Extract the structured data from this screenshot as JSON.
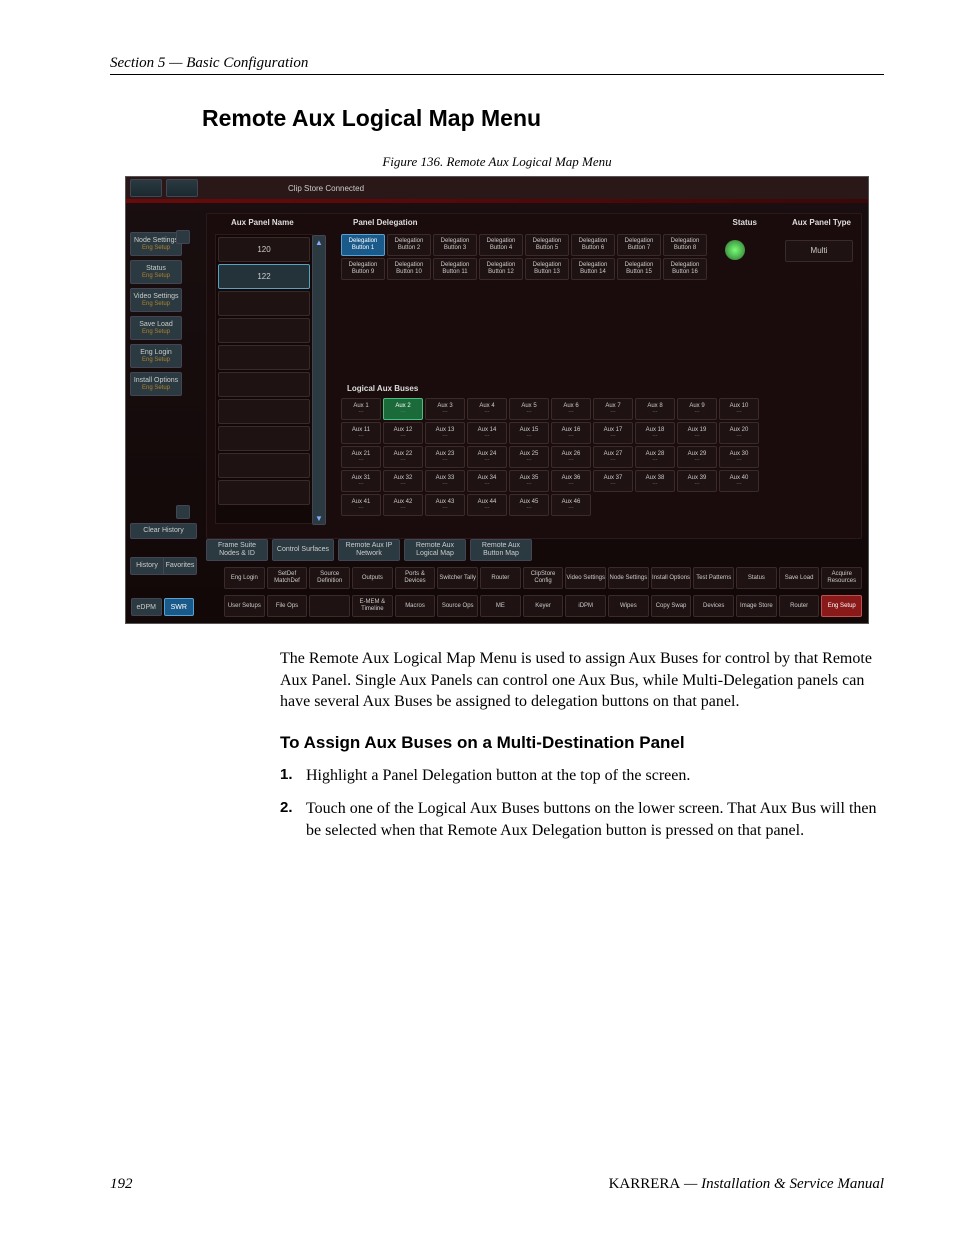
{
  "header": {
    "section_label": "Section 5 — Basic Configuration"
  },
  "heading": "Remote Aux Logical Map Menu",
  "figure_caption": "Figure 136.  Remote Aux Logical Map Menu",
  "screenshot": {
    "topbar_text": "Clip Store Connected",
    "columns": {
      "aux_panel_name": "Aux Panel Name",
      "panel_delegation": "Panel Delegation",
      "status": "Status",
      "aux_panel_type": "Aux Panel Type",
      "logical_aux_buses": "Logical Aux Buses"
    },
    "aux_panel_type_value": "Multi",
    "aux_panel_list": [
      "120",
      "122",
      "",
      "",
      "",
      "",
      "",
      "",
      "",
      ""
    ],
    "delegation_buttons": [
      "Delegation Button 1",
      "Delegation Button 2",
      "Delegation Button 3",
      "Delegation Button 4",
      "Delegation Button 5",
      "Delegation Button 6",
      "Delegation Button 7",
      "Delegation Button 8",
      "Delegation Button 9",
      "Delegation Button 10",
      "Delegation Button 11",
      "Delegation Button 12",
      "Delegation Button 13",
      "Delegation Button 14",
      "Delegation Button 15",
      "Delegation Button 16"
    ],
    "delegation_selected_index": 0,
    "logical_aux": {
      "count": 46,
      "label_prefix": "Aux ",
      "sub": "---",
      "selected_index": 1
    },
    "left_nav": [
      {
        "t": "Node Settings",
        "s": "Eng Setup"
      },
      {
        "t": "Status",
        "s": "Eng Setup"
      },
      {
        "t": "Video Settings",
        "s": "Eng Setup"
      },
      {
        "t": "Save Load",
        "s": "Eng Setup"
      },
      {
        "t": "Eng Login",
        "s": "Eng Setup"
      },
      {
        "t": "Install Options",
        "s": "Eng Setup"
      }
    ],
    "clear_history": "Clear History",
    "history": "History",
    "favorites": "Favorites",
    "edpm": "eDPM",
    "swr": "SWR",
    "sub_tabs": [
      "Frame Suite Nodes & ID",
      "Control Surfaces",
      "Remote Aux IP Network",
      "Remote Aux Logical Map",
      "Remote Aux Button Map"
    ],
    "bottom_row1": [
      "Eng Login",
      "SetDef MatchDef",
      "Source Definition",
      "Outputs",
      "Ports & Devices",
      "Switcher Tally",
      "Router",
      "ClipStore Config",
      "Video Settings",
      "Node Settings",
      "Install Options",
      "Test Patterns",
      "Status",
      "Save Load",
      "Acquire Resources"
    ],
    "bottom_row2": [
      "User Setups",
      "File Ops",
      "",
      "E-MEM & Timeline",
      "Macros",
      "Source Ops",
      "ME",
      "Keyer",
      "iDPM",
      "Wipes",
      "Copy Swap",
      "Devices",
      "Image Store",
      "Router",
      "Eng Setup"
    ],
    "bottom_row2_hot_index": 14
  },
  "paragraph": "The Remote Aux Logical Map Menu is used to assign Aux Buses for control by that Remote Aux Panel. Single Aux Panels can control one Aux Bus, while Multi-Delegation panels can have several Aux Buses be assigned to delegation buttons on that panel.",
  "subheading": "To Assign Aux Buses on a Multi-Destination Panel",
  "steps": [
    "Highlight a Panel Delegation button at the top of the screen.",
    "Touch one of the Logical Aux Buses buttons on the lower screen. That Aux Bus will then be selected when that Remote Aux Delegation button is pressed on that panel."
  ],
  "footer": {
    "page": "192",
    "brand": "KARRERA",
    "title": " — Installation & Service Manual"
  }
}
